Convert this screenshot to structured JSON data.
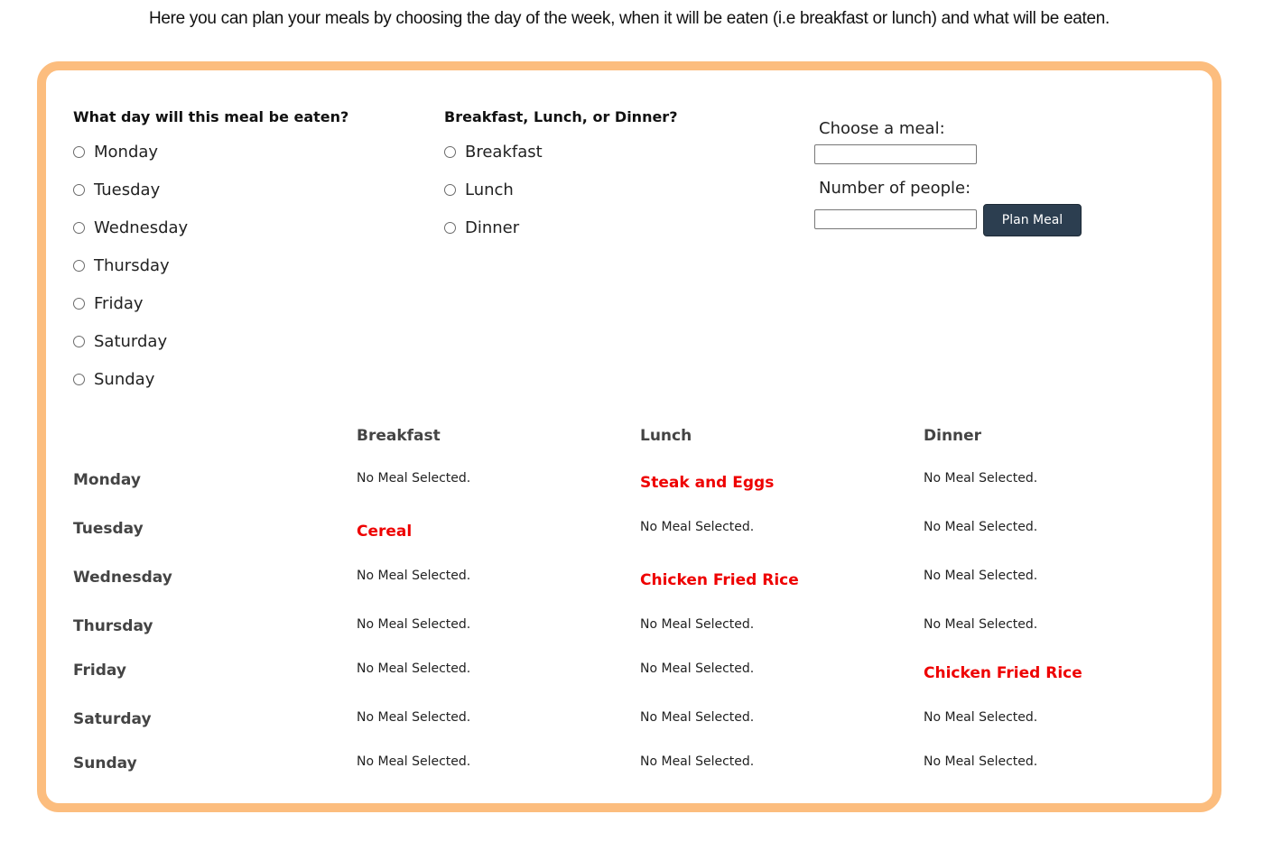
{
  "intro_text": "Here you can plan your meals by choosing the day of the week, when it will be eaten (i.e breakfast or lunch) and what will be eaten.",
  "colors": {
    "panel_border": "#fcbd7e",
    "button_bg": "#2c3e50",
    "meal_text": "#ee0000"
  },
  "day_question": {
    "heading": "What day will this meal be eaten?",
    "options": [
      "Monday",
      "Tuesday",
      "Wednesday",
      "Thursday",
      "Friday",
      "Saturday",
      "Sunday"
    ]
  },
  "meal_time_question": {
    "heading": "Breakfast, Lunch, or Dinner?",
    "options": [
      "Breakfast",
      "Lunch",
      "Dinner"
    ]
  },
  "meal_form": {
    "choose_meal_label": "Choose a meal:",
    "choose_meal_value": "",
    "people_label": "Number of people:",
    "people_value": "",
    "plan_button": "Plan Meal"
  },
  "schedule": {
    "columns": [
      "Breakfast",
      "Lunch",
      "Dinner"
    ],
    "rows": [
      {
        "day": "Monday",
        "cells": [
          "No Meal Selected.",
          "Steak and Eggs",
          "No Meal Selected."
        ]
      },
      {
        "day": "Tuesday",
        "cells": [
          "Cereal",
          "No Meal Selected.",
          "No Meal Selected."
        ]
      },
      {
        "day": "Wednesday",
        "cells": [
          "No Meal Selected.",
          "Chicken Fried Rice",
          "No Meal Selected."
        ]
      },
      {
        "day": "Thursday",
        "cells": [
          "No Meal Selected.",
          "No Meal Selected.",
          "No Meal Selected."
        ]
      },
      {
        "day": "Friday",
        "cells": [
          "No Meal Selected.",
          "No Meal Selected.",
          "Chicken Fried Rice"
        ]
      },
      {
        "day": "Saturday",
        "cells": [
          "No Meal Selected.",
          "No Meal Selected.",
          "No Meal Selected."
        ]
      },
      {
        "day": "Sunday",
        "cells": [
          "No Meal Selected.",
          "No Meal Selected.",
          "No Meal Selected."
        ]
      }
    ]
  }
}
